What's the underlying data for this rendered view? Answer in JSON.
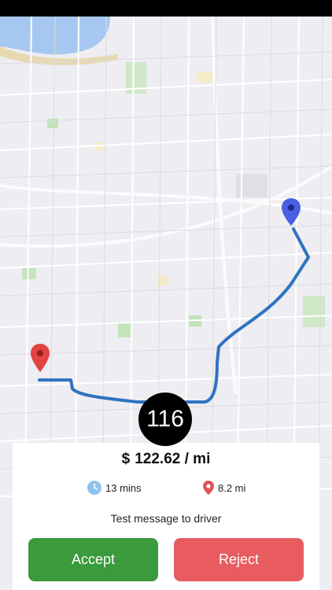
{
  "request": {
    "counter": "116",
    "currency_symbol": "$",
    "rate": "122.62 / mi",
    "time": "13 mins",
    "distance": "8.2 mi",
    "message": "Test message to driver"
  },
  "actions": {
    "accept_label": "Accept",
    "reject_label": "Reject"
  },
  "colors": {
    "route": "#2f73c2",
    "pickup_pin": "#4a5fe0",
    "dropoff_pin": "#e24343",
    "accept": "#3a9a3c",
    "reject": "#e85c5f"
  },
  "icons": {
    "time": "clock-icon",
    "distance": "location-pin-icon"
  }
}
